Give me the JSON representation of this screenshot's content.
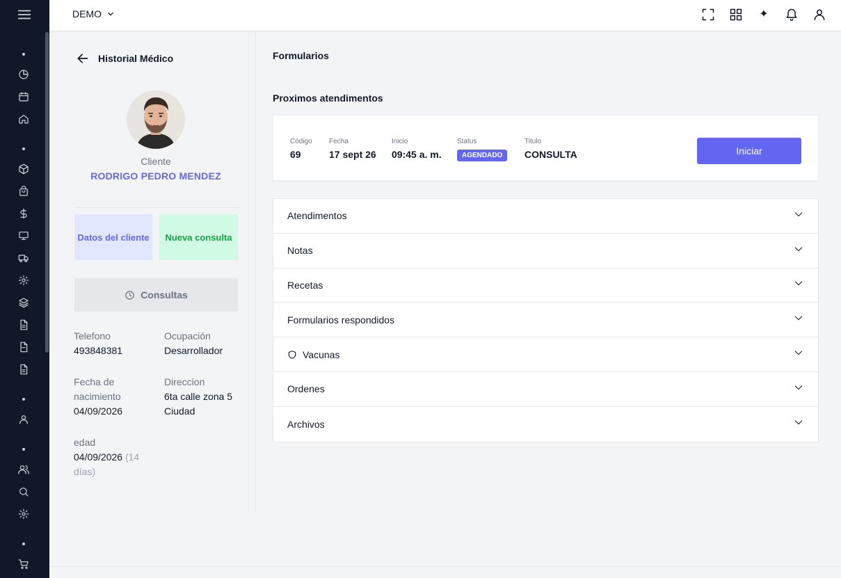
{
  "header": {
    "org": "DEMO",
    "icons": [
      "fullscreen-icon",
      "grid-icon",
      "sparkle-icon",
      "bell-icon",
      "user-icon"
    ],
    "sparkle": "✦"
  },
  "sidebar": {
    "icons": [
      "chart-pie-icon",
      "calendar-icon",
      "home-icon",
      "cube-icon",
      "bag-icon",
      "dollar-icon",
      "monitor-icon",
      "truck-icon",
      "gear-icon",
      "layers-icon",
      "file-icon",
      "file-icon",
      "file-icon",
      "user-icon",
      "users-icon",
      "search-icon",
      "gear-icon",
      "cart-icon"
    ]
  },
  "left": {
    "back_title": "Historial Médico",
    "role": "Cliente",
    "client_name": "RODRIGO PEDRO MENDEZ",
    "btn_datos": "Datos del cliente",
    "btn_nueva": "Nueva consulta",
    "btn_consultas": "Consultas",
    "telefono_label": "Telefono",
    "telefono": "493848381",
    "ocupacion_label": "Ocupación",
    "ocupacion": "Desarrollador",
    "nacimiento_label": "Fecha de nacimiento",
    "nacimiento": "04/09/2026",
    "direccion_label": "Direccion",
    "direccion": "6ta calle zona 5 Ciudad",
    "edad_label": "edad",
    "edad": "04/09/2026",
    "edad_dias": "(14 días)"
  },
  "main": {
    "formularios": "Formularios",
    "proximos": "Proximos atendimentos",
    "card": {
      "codigo_label": "Código",
      "codigo": "69",
      "fecha_label": "Fecha",
      "fecha": "17 sept 26",
      "inicio_label": "Inicio",
      "inicio": "09:45 a. m.",
      "status_label": "Status",
      "status": "AGENDADO",
      "titulo_label": "Titulo",
      "titulo": "CONSULTA",
      "iniciar": "Iniciar"
    },
    "accordion": [
      {
        "label": "Atendimentos"
      },
      {
        "label": "Notas"
      },
      {
        "label": "Recetas"
      },
      {
        "label": "Formularios respondidos"
      },
      {
        "label": "Vacunas"
      },
      {
        "label": "Ordenes"
      },
      {
        "label": "Archivos"
      }
    ]
  },
  "colors": {
    "accent": "#6366f1",
    "sidebar": "#111827",
    "success": "#16a34a"
  }
}
